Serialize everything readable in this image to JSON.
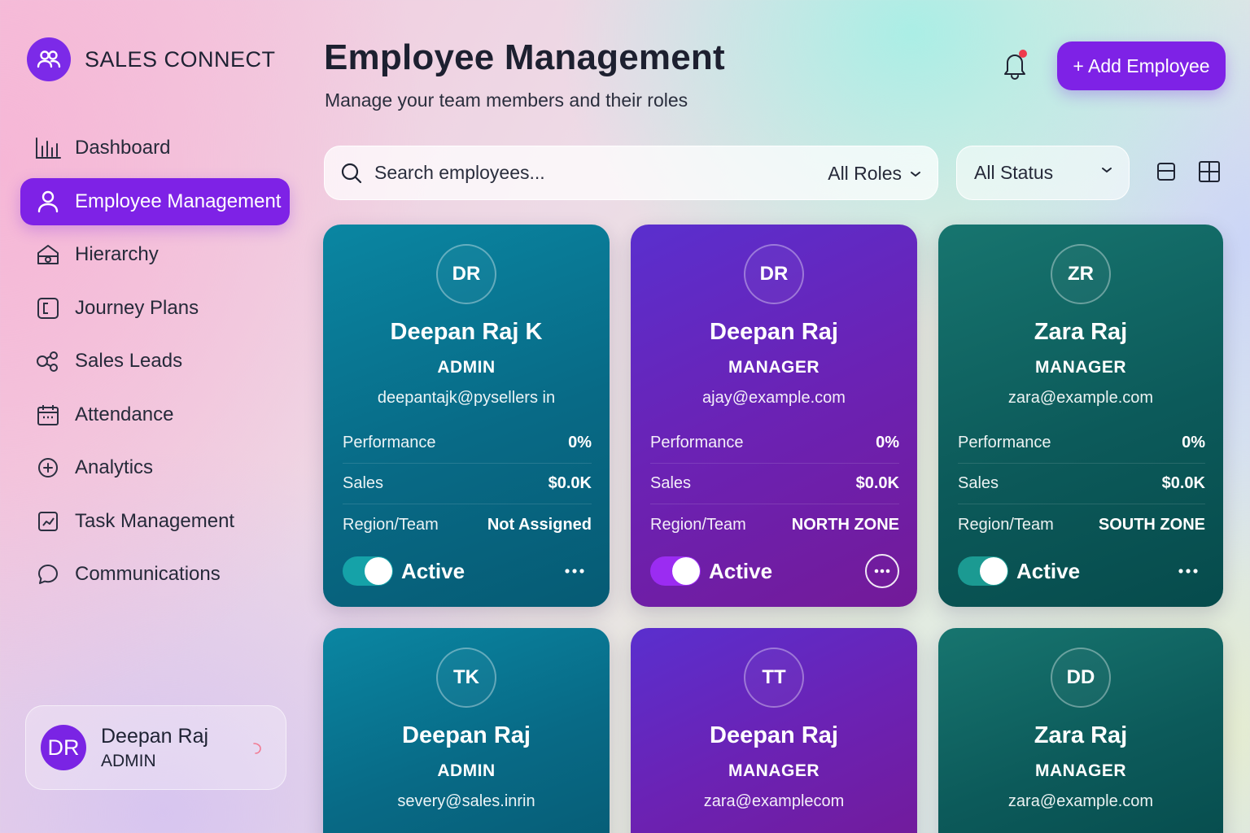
{
  "brand": {
    "name": "SALES CONNECT",
    "icon": "users-icon"
  },
  "sidebar": {
    "items": [
      {
        "label": "Dashboard",
        "icon": "bar-chart-icon",
        "active": false
      },
      {
        "label": "Employee Management",
        "icon": "user-icon",
        "active": true
      },
      {
        "label": "Hierarchy",
        "icon": "hierarchy-icon",
        "active": false
      },
      {
        "label": "Journey Plans",
        "icon": "journey-icon",
        "active": false
      },
      {
        "label": "Sales Leads",
        "icon": "leads-icon",
        "active": false
      },
      {
        "label": "Attendance",
        "icon": "calendar-icon",
        "active": false
      },
      {
        "label": "Analytics",
        "icon": "plus-circle-icon",
        "active": false
      },
      {
        "label": "Task Management",
        "icon": "task-chart-icon",
        "active": false
      },
      {
        "label": "Communications",
        "icon": "chat-bubble-icon",
        "active": false
      }
    ],
    "user": {
      "initials": "DR",
      "name": "Deepan Raj",
      "role": "ADMIN"
    }
  },
  "header": {
    "title": "Employee Management",
    "subtitle": "Manage your team members and their roles",
    "add_button": "+ Add Employee",
    "notification_dot": true
  },
  "toolbar": {
    "search_placeholder": "Search employees...",
    "roles_filter": "All Roles",
    "status_filter": "All Status"
  },
  "colors": {
    "accent": "#7e22e6",
    "teal_card": "#086a86",
    "purple_card": "#6b22b4",
    "green_card": "#0c5a5a",
    "notification": "#ef3b4c"
  },
  "labels": {
    "performance": "Performance",
    "sales": "Sales",
    "region": "Region/Team"
  },
  "employees": [
    {
      "initials": "DR",
      "name": "Deepan Raj K",
      "role": "ADMIN",
      "email": "deepantajk@pysellers in",
      "performance": "0%",
      "sales": "$0.0K",
      "region": "Not Assigned",
      "status": "Active",
      "theme": "teal"
    },
    {
      "initials": "DR",
      "name": "Deepan Raj",
      "role": "MANAGER",
      "email": "ajay@example.com",
      "performance": "0%",
      "sales": "$0.0K",
      "region": "NORTH ZONE",
      "status": "Active",
      "theme": "purple"
    },
    {
      "initials": "ZR",
      "name": "Zara Raj",
      "role": "MANAGER",
      "email": "zara@example.com",
      "performance": "0%",
      "sales": "$0.0K",
      "region": "SOUTH ZONE",
      "status": "Active",
      "theme": "green"
    },
    {
      "initials": "TK",
      "name": "Deepan Raj",
      "role": "ADMIN",
      "email": "severy@sales.inrin",
      "theme": "teal"
    },
    {
      "initials": "TT",
      "name": "Deepan Raj",
      "role": "MANAGER",
      "email": "zara@examplecom",
      "theme": "purple"
    },
    {
      "initials": "DD",
      "name": "Zara Raj",
      "role": "MANAGER",
      "email": "zara@example.com",
      "theme": "green"
    }
  ]
}
